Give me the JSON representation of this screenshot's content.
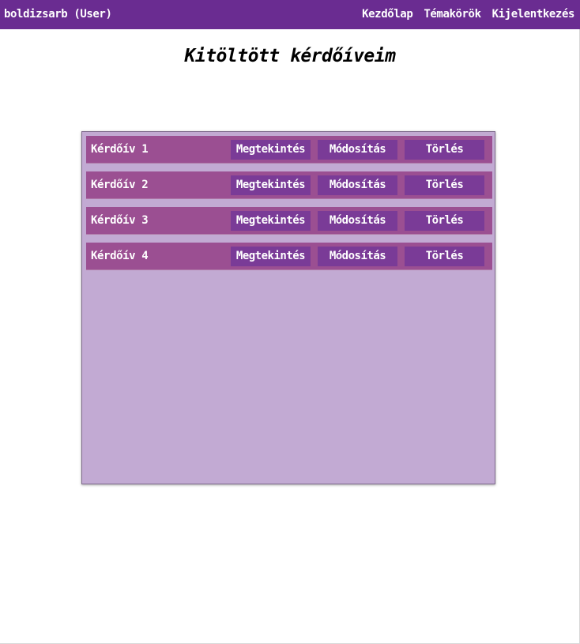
{
  "colors": {
    "navbar": "#6a2c91",
    "panel": "#c2aad3",
    "row": "#9b4f92",
    "button": "#7a3b97",
    "text_light": "#ffffff"
  },
  "navbar": {
    "user": "boldizsarb (User)",
    "links": [
      "Kezdőlap",
      "Témakörök",
      "Kijelentkezés"
    ]
  },
  "title": "Kitöltött kérdőíveim",
  "questionnaires": [
    {
      "name": "Kérdőív 1",
      "view": "Megtekintés",
      "edit": "Módosítás",
      "delete": "Törlés"
    },
    {
      "name": "Kérdőív 2",
      "view": "Megtekintés",
      "edit": "Módosítás",
      "delete": "Törlés"
    },
    {
      "name": "Kérdőív 3",
      "view": "Megtekintés",
      "edit": "Módosítás",
      "delete": "Törlés"
    },
    {
      "name": "Kérdőív 4",
      "view": "Megtekintés",
      "edit": "Módosítás",
      "delete": "Törlés"
    }
  ]
}
